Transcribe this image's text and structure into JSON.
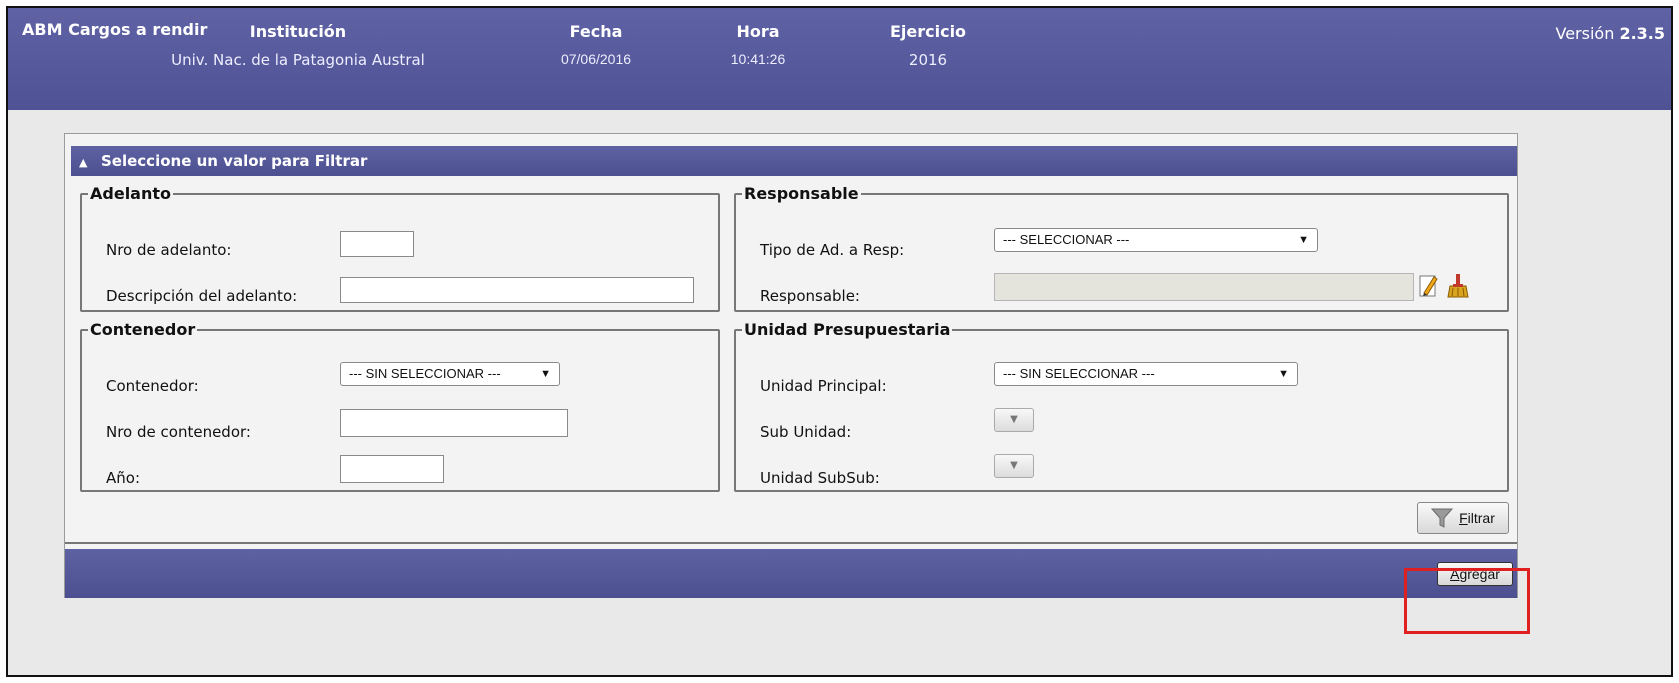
{
  "header": {
    "app_title": "ABM Cargos a rendir",
    "version_label": "Versión",
    "version_number": "2.3.5",
    "columns": [
      {
        "label": "Institución",
        "value": "Univ. Nac. de la Patagonia Austral"
      },
      {
        "label": "Fecha",
        "value": "07/06/2016"
      },
      {
        "label": "Hora",
        "value": "10:41:26"
      },
      {
        "label": "Ejercicio",
        "value": "2016"
      }
    ]
  },
  "filter": {
    "title": "Seleccione un valor para Filtrar",
    "adelanto": {
      "legend": "Adelanto",
      "nro_label": "Nro de adelanto:",
      "nro_value": "",
      "desc_label": "Descripción del adelanto:",
      "desc_value": ""
    },
    "responsable": {
      "legend": "Responsable",
      "tipo_label": "Tipo de Ad. a Resp:",
      "tipo_selected": "--- SELECCIONAR ---",
      "resp_label": "Responsable:",
      "resp_value": ""
    },
    "contenedor": {
      "legend": "Contenedor",
      "cont_label": "Contenedor:",
      "cont_selected": "--- SIN SELECCIONAR ---",
      "nro_label": "Nro de contenedor:",
      "nro_value": "",
      "anio_label": "Año:",
      "anio_value": ""
    },
    "unidad": {
      "legend": "Unidad Presupuestaria",
      "principal_label": "Unidad Principal:",
      "principal_selected": "--- SIN SELECCIONAR ---",
      "sub_label": "Sub Unidad:",
      "subsub_label": "Unidad SubSub:"
    },
    "filter_button": {
      "mnemonic": "F",
      "rest": "iltrar"
    }
  },
  "footer": {
    "add_button": {
      "mnemonic": "A",
      "rest": "gregar"
    }
  },
  "icons": [
    "edit-icon",
    "clear-broom-icon",
    "funnel-icon",
    "collapse-triangle-icon",
    "dropdown-arrow-icon"
  ],
  "colors": {
    "header_bg": "#5a5d9f",
    "highlight": "#e02020"
  }
}
